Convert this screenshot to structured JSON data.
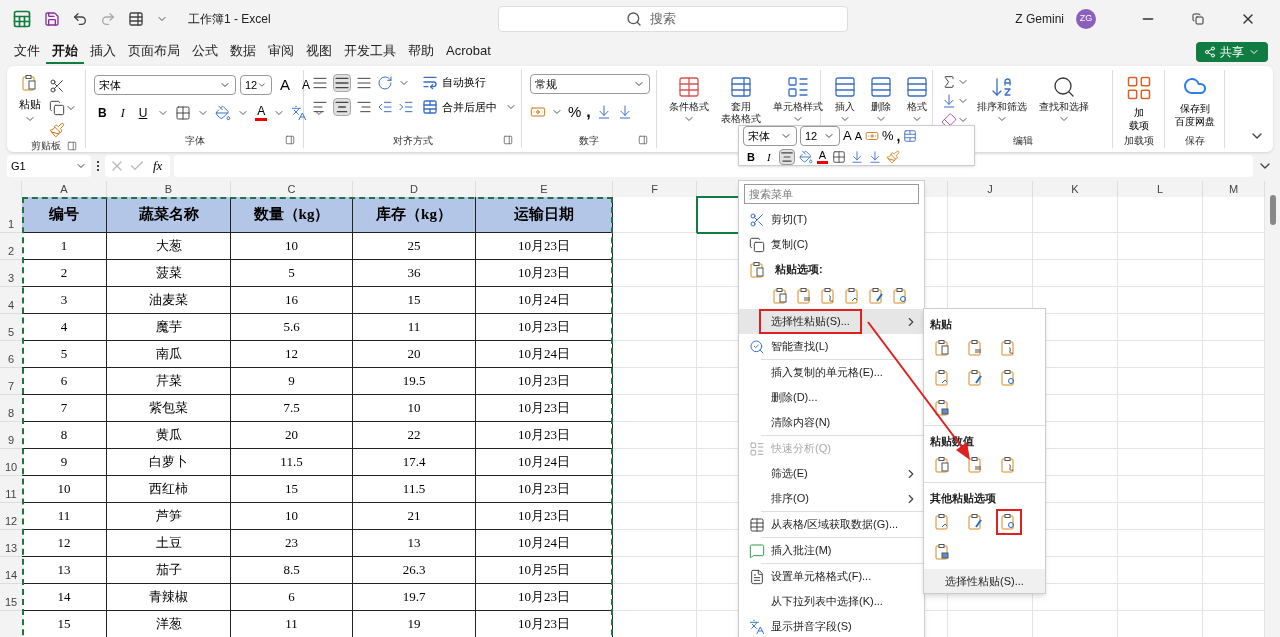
{
  "title_bar": {
    "title": "工作簿1  -  Excel",
    "search_placeholder": "搜索",
    "user": "Z Gemini",
    "avatar": "ZG"
  },
  "menu_tabs": [
    {
      "label": "文件",
      "selected": false
    },
    {
      "label": "开始",
      "selected": true
    },
    {
      "label": "插入",
      "selected": false
    },
    {
      "label": "页面布局",
      "selected": false
    },
    {
      "label": "公式",
      "selected": false
    },
    {
      "label": "数据",
      "selected": false
    },
    {
      "label": "审阅",
      "selected": false
    },
    {
      "label": "视图",
      "selected": false
    },
    {
      "label": "开发工具",
      "selected": false
    },
    {
      "label": "帮助",
      "selected": false
    },
    {
      "label": "Acrobat",
      "selected": false
    }
  ],
  "share": "共享",
  "ribbon": {
    "clipboard": {
      "paste": "粘贴",
      "label": "剪贴板"
    },
    "font": {
      "font": "宋体",
      "size": "12",
      "grow": "A",
      "shrink": "A",
      "bold": "B",
      "italic": "I",
      "underline": "U",
      "font_color_letter": "A",
      "label": "字体"
    },
    "alignment": {
      "wrap": "自动换行",
      "merge": "合并后居中",
      "label": "对齐方式"
    },
    "number": {
      "format": "常规",
      "percent": "%",
      "comma": ",",
      "label": "数字"
    },
    "styles": [
      {
        "lines": [
          "条件格式"
        ]
      },
      {
        "lines": [
          "套用",
          "表格格式"
        ]
      },
      {
        "lines": [
          "单元格样式"
        ]
      }
    ],
    "cells": [
      "插入",
      "删除",
      "格式"
    ],
    "editing": {
      "sort": "排序和筛选",
      "find": "查找和选择",
      "label": "编辑"
    },
    "addins": {
      "lines": [
        "加",
        "载项"
      ],
      "label": "加载项"
    },
    "save": {
      "lines": [
        "保存到",
        "百度网盘"
      ],
      "label": "保存"
    }
  },
  "formula_bar": {
    "name_box": "G1",
    "fx": "fx"
  },
  "sheet": {
    "columns": [
      "A",
      "B",
      "C",
      "D",
      "E",
      "F"
    ],
    "right_columns": [
      "J",
      "K",
      "L",
      "M"
    ],
    "row_numbers": [
      "1",
      "2",
      "3",
      "4",
      "5",
      "6",
      "7",
      "8",
      "9",
      "10",
      "11",
      "12",
      "13",
      "14",
      "15"
    ],
    "header": [
      "编号",
      "蔬菜名称",
      "数量（kg）",
      "库存（kg）",
      "运输日期"
    ],
    "rows": [
      [
        "1",
        "大葱",
        "10",
        "25",
        "10月23日"
      ],
      [
        "2",
        "菠菜",
        "5",
        "36",
        "10月23日"
      ],
      [
        "3",
        "油麦菜",
        "16",
        "15",
        "10月24日"
      ],
      [
        "4",
        "魔芋",
        "5.6",
        "11",
        "10月23日"
      ],
      [
        "5",
        "南瓜",
        "12",
        "20",
        "10月24日"
      ],
      [
        "6",
        "芹菜",
        "9",
        "19.5",
        "10月23日"
      ],
      [
        "7",
        "紫包菜",
        "7.5",
        "10",
        "10月23日"
      ],
      [
        "8",
        "黄瓜",
        "20",
        "22",
        "10月23日"
      ],
      [
        "9",
        "白萝卜",
        "11.5",
        "17.4",
        "10月24日"
      ],
      [
        "10",
        "西红柿",
        "15",
        "11.5",
        "10月23日"
      ],
      [
        "11",
        "芦笋",
        "10",
        "21",
        "10月23日"
      ],
      [
        "12",
        "土豆",
        "23",
        "13",
        "10月24日"
      ],
      [
        "13",
        "茄子",
        "8.5",
        "26.3",
        "10月25日"
      ],
      [
        "14",
        "青辣椒",
        "6",
        "19.7",
        "10月23日"
      ],
      [
        "15",
        "洋葱",
        "11",
        "19",
        "10月23日"
      ]
    ]
  },
  "mini_toolbar": {
    "font": "宋体",
    "size": "12",
    "grow": "A",
    "shrink": "A",
    "percent": "%",
    "comma": ",",
    "bold": "B",
    "italic": "I",
    "font_color_letter": "A",
    "align_selected": true
  },
  "context_menu": {
    "search_placeholder": "搜索菜单",
    "items": [
      {
        "kind": "item",
        "label": "剪切(T)",
        "selected": false,
        "disabled": false,
        "has_submenu": false,
        "highlighted": false
      },
      {
        "kind": "item",
        "label": "复制(C)",
        "selected": false,
        "disabled": false,
        "has_submenu": false,
        "highlighted": false
      },
      {
        "kind": "header",
        "label": "粘贴选项:"
      },
      {
        "kind": "paste_icons"
      },
      {
        "kind": "item",
        "label": "选择性粘贴(S)...",
        "selected": true,
        "disabled": false,
        "has_submenu": true,
        "highlighted": true
      },
      {
        "kind": "item",
        "label": "智能查找(L)",
        "selected": false,
        "disabled": false,
        "has_submenu": false,
        "highlighted": false
      },
      {
        "kind": "separator"
      },
      {
        "kind": "item",
        "label": "插入复制的单元格(E)...",
        "selected": false,
        "disabled": false,
        "has_submenu": false,
        "highlighted": false
      },
      {
        "kind": "item",
        "label": "删除(D)...",
        "selected": false,
        "disabled": false,
        "has_submenu": false,
        "highlighted": false
      },
      {
        "kind": "item",
        "label": "清除内容(N)",
        "selected": false,
        "disabled": false,
        "has_submenu": false,
        "highlighted": false
      },
      {
        "kind": "separator"
      },
      {
        "kind": "item",
        "label": "快速分析(Q)",
        "selected": false,
        "disabled": true,
        "has_submenu": false,
        "highlighted": false
      },
      {
        "kind": "item",
        "label": "筛选(E)",
        "selected": false,
        "disabled": false,
        "has_submenu": true,
        "highlighted": false
      },
      {
        "kind": "item",
        "label": "排序(O)",
        "selected": false,
        "disabled": false,
        "has_submenu": true,
        "highlighted": false
      },
      {
        "kind": "separator"
      },
      {
        "kind": "item",
        "label": "从表格/区域获取数据(G)...",
        "selected": false,
        "disabled": false,
        "has_submenu": false,
        "highlighted": false
      },
      {
        "kind": "separator"
      },
      {
        "kind": "item",
        "label": "插入批注(M)",
        "selected": false,
        "disabled": false,
        "has_submenu": false,
        "highlighted": false
      },
      {
        "kind": "separator"
      },
      {
        "kind": "item",
        "label": "设置单元格格式(F)...",
        "selected": false,
        "disabled": false,
        "has_submenu": false,
        "highlighted": false
      },
      {
        "kind": "item",
        "label": "从下拉列表中选择(K)...",
        "selected": false,
        "disabled": false,
        "has_submenu": false,
        "highlighted": false
      },
      {
        "kind": "item",
        "label": "显示拼音字段(S)",
        "selected": false,
        "disabled": false,
        "has_submenu": false,
        "highlighted": false
      }
    ]
  },
  "submenu": {
    "sections": [
      {
        "title": "粘贴",
        "icons": [
          {
            "highlighted": false
          },
          {
            "highlighted": false
          },
          {
            "highlighted": false
          },
          {
            "highlighted": false
          },
          {
            "highlighted": false
          },
          {
            "highlighted": false
          },
          {
            "highlighted": false
          }
        ]
      },
      {
        "title": "粘贴数值",
        "icons": [
          {
            "highlighted": false
          },
          {
            "highlighted": false
          },
          {
            "highlighted": false
          }
        ]
      },
      {
        "title": "其他粘贴选项",
        "icons": [
          {
            "highlighted": false
          },
          {
            "highlighted": false
          },
          {
            "highlighted": true
          },
          {
            "highlighted": false
          }
        ]
      }
    ],
    "footer": "选择性粘贴(S)..."
  }
}
